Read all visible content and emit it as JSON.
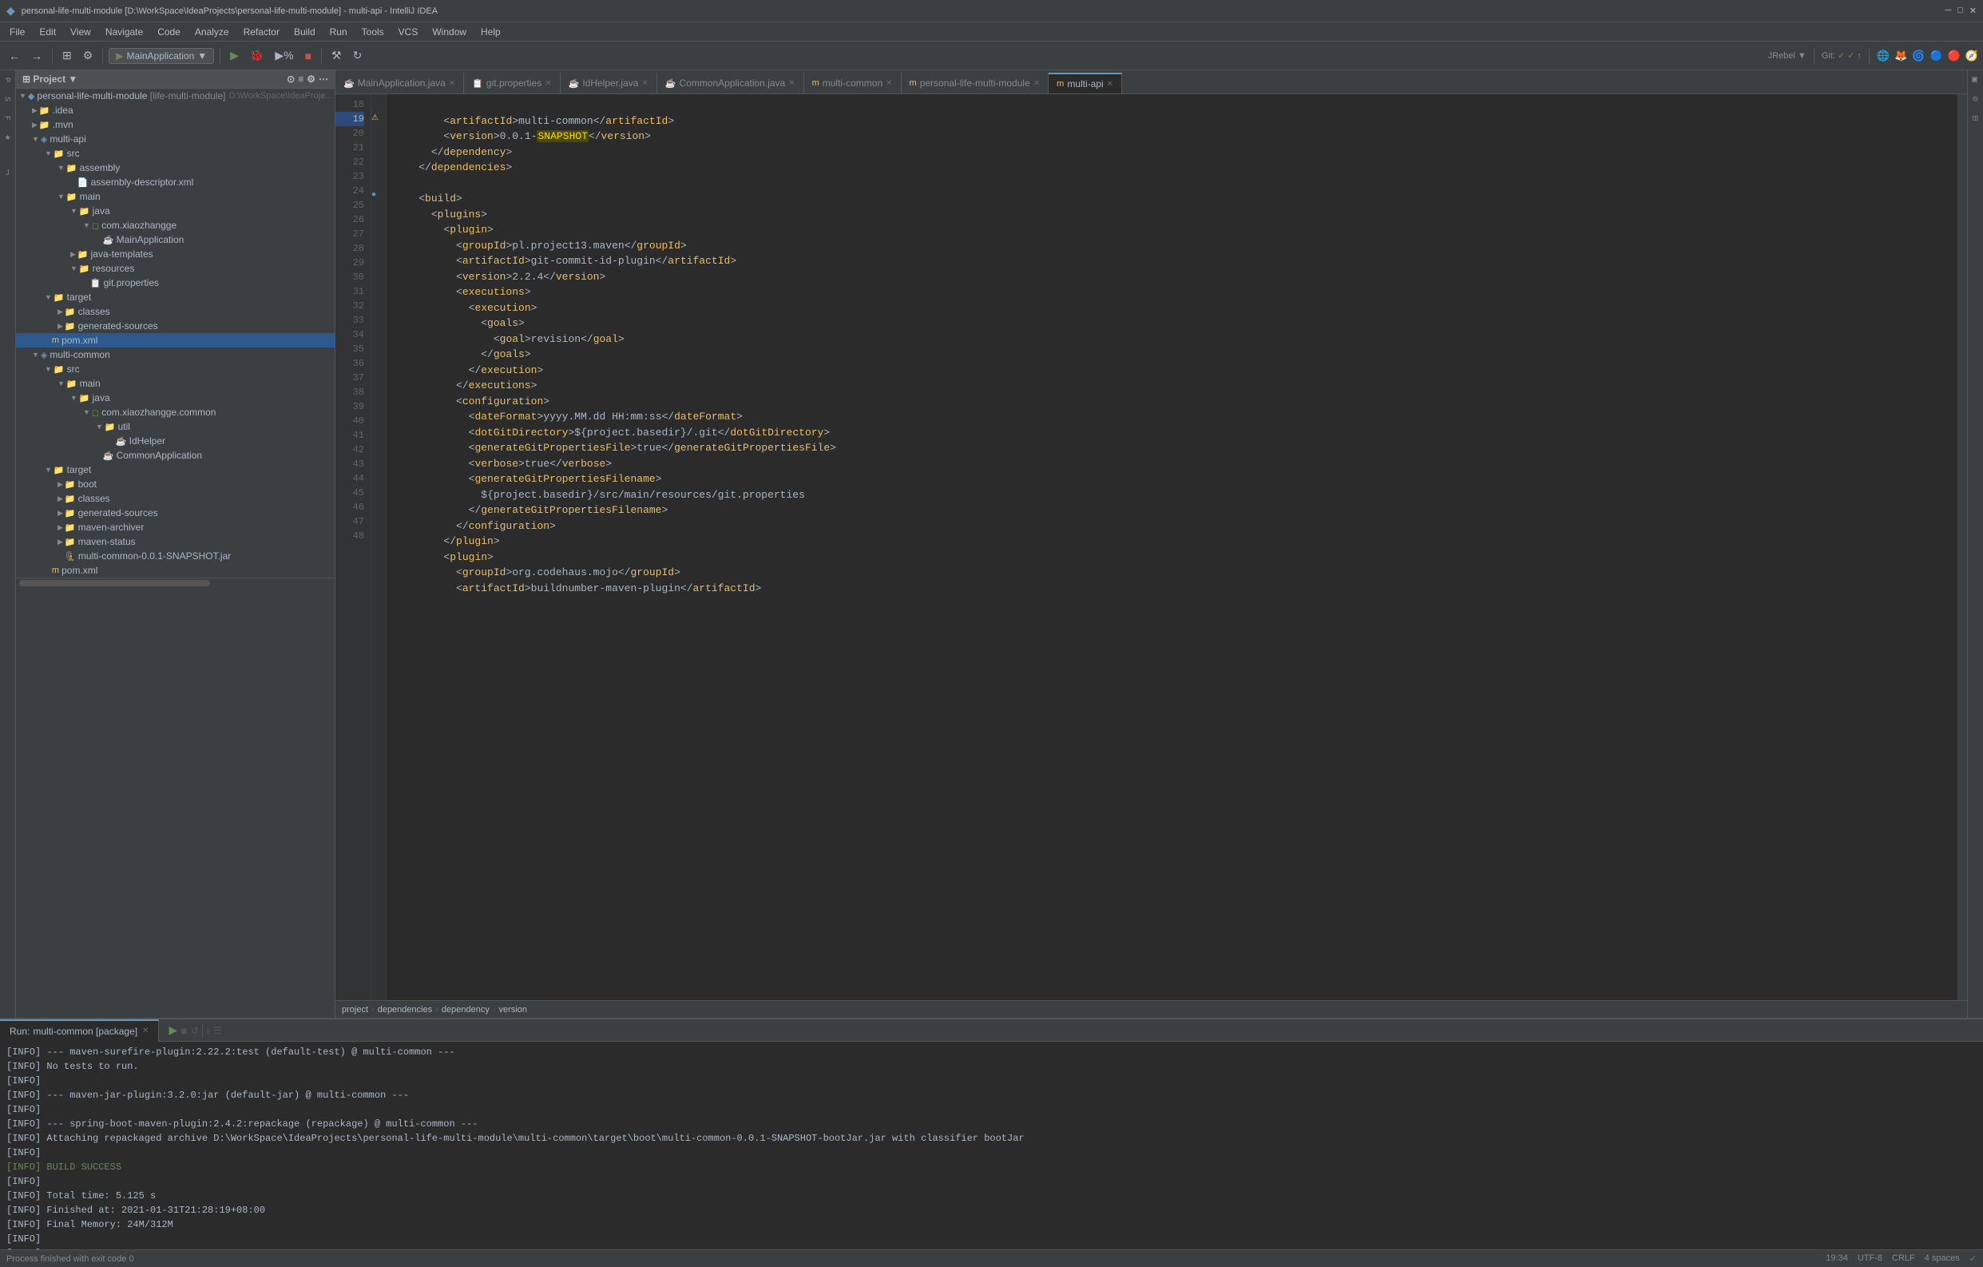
{
  "titleBar": {
    "text": "personal-life-multi-module [D:\\WorkSpace\\IdeaProjects\\personal-life-multi-module] - multi-api - IntelliJ IDEA"
  },
  "menuBar": {
    "items": [
      "File",
      "Edit",
      "View",
      "Navigate",
      "Code",
      "Analyze",
      "Refactor",
      "Build",
      "Run",
      "Tools",
      "VCS",
      "Window",
      "Help"
    ]
  },
  "toolbar": {
    "runConfig": "MainApplication",
    "gitBranch": "Git:"
  },
  "projectPanel": {
    "title": "Project",
    "rootLabel": "personal-life-multi-module [life-multi-module]",
    "rootPath": "D:\\WorkSpace\\IdeaProjects\\personal-life"
  },
  "tabs": [
    {
      "label": "MainApplication.java",
      "type": "java",
      "active": false
    },
    {
      "label": "git.properties",
      "type": "props",
      "active": false
    },
    {
      "label": "IdHelper.java",
      "type": "java",
      "active": false
    },
    {
      "label": "CommonApplication.java",
      "type": "java",
      "active": false
    },
    {
      "label": "multi-common",
      "type": "mvn",
      "active": false
    },
    {
      "label": "personal-life-multi-module",
      "type": "mvn",
      "active": false
    },
    {
      "label": "multi-api",
      "type": "mvn",
      "active": true
    }
  ],
  "editor": {
    "lines": [
      {
        "num": 18,
        "content": "    <artifactId>multi-common</artifactId>"
      },
      {
        "num": 19,
        "content": "    <version>0.0.1-SNAPSHOT</version>"
      },
      {
        "num": 20,
        "content": "  </dependency>"
      },
      {
        "num": 21,
        "content": "</dependencies>"
      },
      {
        "num": 22,
        "content": ""
      },
      {
        "num": 23,
        "content": "<build>"
      },
      {
        "num": 24,
        "content": "  <plugins>"
      },
      {
        "num": 25,
        "content": "    <plugin>"
      },
      {
        "num": 26,
        "content": "      <groupId>pl.project13.maven</groupId>"
      },
      {
        "num": 27,
        "content": "      <artifactId>git-commit-id-plugin</artifactId>"
      },
      {
        "num": 28,
        "content": "      <version>2.2.4</version>"
      },
      {
        "num": 29,
        "content": "      <executions>"
      },
      {
        "num": 30,
        "content": "        <execution>"
      },
      {
        "num": 31,
        "content": "          <goals>"
      },
      {
        "num": 32,
        "content": "            <goal>revision</goal>"
      },
      {
        "num": 33,
        "content": "          </goals>"
      },
      {
        "num": 34,
        "content": "        </execution>"
      },
      {
        "num": 35,
        "content": "      </executions>"
      },
      {
        "num": 36,
        "content": "      <configuration>"
      },
      {
        "num": 37,
        "content": "        <dateFormat>yyyy.MM.dd HH:mm:ss</dateFormat>"
      },
      {
        "num": 38,
        "content": "        <dotGitDirectory>${project.basedir}/.git</dotGitDirectory>"
      },
      {
        "num": 39,
        "content": "        <generateGitPropertiesFile>true</generateGitPropertiesFile>"
      },
      {
        "num": 40,
        "content": "        <verbose>true</verbose>"
      },
      {
        "num": 41,
        "content": "        <generateGitPropertiesFilename>"
      },
      {
        "num": 42,
        "content": "          ${project.basedir}/src/main/resources/git.properties"
      },
      {
        "num": 43,
        "content": "        </generateGitPropertiesFilename>"
      },
      {
        "num": 44,
        "content": "      </configuration>"
      },
      {
        "num": 45,
        "content": "    </plugin>"
      },
      {
        "num": 46,
        "content": "    <plugin>"
      },
      {
        "num": 47,
        "content": "      <groupId>org.codehaus.mojo</groupId>"
      },
      {
        "num": 48,
        "content": "      <artifactId>buildnumber-maven-plugin</artifactId>"
      }
    ]
  },
  "breadcrumb": {
    "items": [
      "project",
      "dependencies",
      "dependency",
      "version"
    ]
  },
  "bottomPanel": {
    "tabs": [
      {
        "label": "Run:",
        "badge": "multi-common [package]",
        "active": true
      }
    ],
    "consoleLines": [
      "[INFO] --- maven-surefire-plugin:2.22.2:test (default-test) @ multi-common ---",
      "[INFO] No tests to run.",
      "[INFO]",
      "[INFO] --- maven-jar-plugin:3.2.0:jar (default-jar) @ multi-common ---",
      "[INFO]",
      "[INFO] --- spring-boot-maven-plugin:2.4.2:repackage (repackage) @ multi-common ---",
      "[INFO] Attaching repackaged archive D:\\WorkSpace\\IdeaProjects\\personal-life-multi-module\\multi-common\\target\\boot\\multi-common-0.0.1-SNAPSHOT-bootJar.jar with classifier bootJar",
      "[INFO]",
      "[INFO] BUILD SUCCESS",
      "[INFO]",
      "[INFO] Total time: 5.125 s",
      "[INFO] Finished at: 2021-01-31T21:28:19+08:00",
      "[INFO] Final Memory: 24M/312M",
      "[INFO]",
      "[INFO] ------------------------------------------------------------------------"
    ]
  },
  "statusBar": {
    "left": "Process finished with exit code 0",
    "right": {
      "lineCol": "19:34",
      "encoding": "UTF-8",
      "lineSep": "CRLF",
      "indent": "4 spaces"
    }
  },
  "treeItems": [
    {
      "id": "root",
      "indent": 0,
      "label": "personal-life-multi-module [life-multi-module]",
      "type": "root",
      "expanded": true
    },
    {
      "id": "idea",
      "indent": 1,
      "label": ".idea",
      "type": "folder",
      "expanded": false
    },
    {
      "id": "mvn",
      "indent": 1,
      "label": ".mvn",
      "type": "folder",
      "expanded": false
    },
    {
      "id": "multi-api",
      "indent": 1,
      "label": "multi-api",
      "type": "module",
      "expanded": true
    },
    {
      "id": "src",
      "indent": 2,
      "label": "src",
      "type": "folder",
      "expanded": true
    },
    {
      "id": "assembly",
      "indent": 3,
      "label": "assembly",
      "type": "folder",
      "expanded": true
    },
    {
      "id": "assembly-descriptor",
      "indent": 4,
      "label": "assembly-descriptor.xml",
      "type": "xml",
      "expanded": false
    },
    {
      "id": "main",
      "indent": 3,
      "label": "main",
      "type": "folder",
      "expanded": true
    },
    {
      "id": "java",
      "indent": 4,
      "label": "java",
      "type": "folder",
      "expanded": true
    },
    {
      "id": "com.xiaozhangge",
      "indent": 5,
      "label": "com.xiaozhangge",
      "type": "package",
      "expanded": true
    },
    {
      "id": "MainApplication",
      "indent": 6,
      "label": "MainApplication",
      "type": "java",
      "expanded": false
    },
    {
      "id": "java-templates",
      "indent": 4,
      "label": "java-templates",
      "type": "folder",
      "expanded": false
    },
    {
      "id": "resources",
      "indent": 4,
      "label": "resources",
      "type": "folder",
      "expanded": true
    },
    {
      "id": "git.properties",
      "indent": 5,
      "label": "git.properties",
      "type": "props",
      "expanded": false
    },
    {
      "id": "target",
      "indent": 2,
      "label": "target",
      "type": "folder",
      "expanded": true
    },
    {
      "id": "classes",
      "indent": 3,
      "label": "classes",
      "type": "folder",
      "expanded": false
    },
    {
      "id": "generated-sources",
      "indent": 3,
      "label": "generated-sources",
      "type": "folder",
      "expanded": false
    },
    {
      "id": "pom-api",
      "indent": 2,
      "label": "pom.xml",
      "type": "xml",
      "selected": true,
      "expanded": false
    },
    {
      "id": "multi-common",
      "indent": 1,
      "label": "multi-common",
      "type": "module",
      "expanded": true
    },
    {
      "id": "src-common",
      "indent": 2,
      "label": "src",
      "type": "folder",
      "expanded": true
    },
    {
      "id": "main-common",
      "indent": 3,
      "label": "main",
      "type": "folder",
      "expanded": true
    },
    {
      "id": "java-common",
      "indent": 4,
      "label": "java",
      "type": "folder",
      "expanded": true
    },
    {
      "id": "com.xiaozhangge.common",
      "indent": 5,
      "label": "com.xiaozhangge.common",
      "type": "package",
      "expanded": true
    },
    {
      "id": "util",
      "indent": 6,
      "label": "util",
      "type": "folder",
      "expanded": true
    },
    {
      "id": "IdHelper",
      "indent": 7,
      "label": "IdHelper",
      "type": "java",
      "expanded": false
    },
    {
      "id": "CommonApplication",
      "indent": 6,
      "label": "CommonApplication",
      "type": "java",
      "expanded": false
    },
    {
      "id": "target-common",
      "indent": 2,
      "label": "target",
      "type": "folder",
      "expanded": true
    },
    {
      "id": "boot",
      "indent": 3,
      "label": "boot",
      "type": "folder",
      "expanded": false
    },
    {
      "id": "classes-common",
      "indent": 3,
      "label": "classes",
      "type": "folder",
      "expanded": false
    },
    {
      "id": "generated-sources-common",
      "indent": 3,
      "label": "generated-sources",
      "type": "folder",
      "expanded": false
    },
    {
      "id": "maven-archiver",
      "indent": 3,
      "label": "maven-archiver",
      "type": "folder",
      "expanded": false
    },
    {
      "id": "maven-status",
      "indent": 3,
      "label": "maven-status",
      "type": "folder",
      "expanded": false
    },
    {
      "id": "snapshot-jar",
      "indent": 3,
      "label": "multi-common-0.0.1-SNAPSHOT.jar",
      "type": "jar",
      "expanded": false
    },
    {
      "id": "pom-common",
      "indent": 2,
      "label": "pom.xml",
      "type": "xml",
      "expanded": false
    }
  ]
}
